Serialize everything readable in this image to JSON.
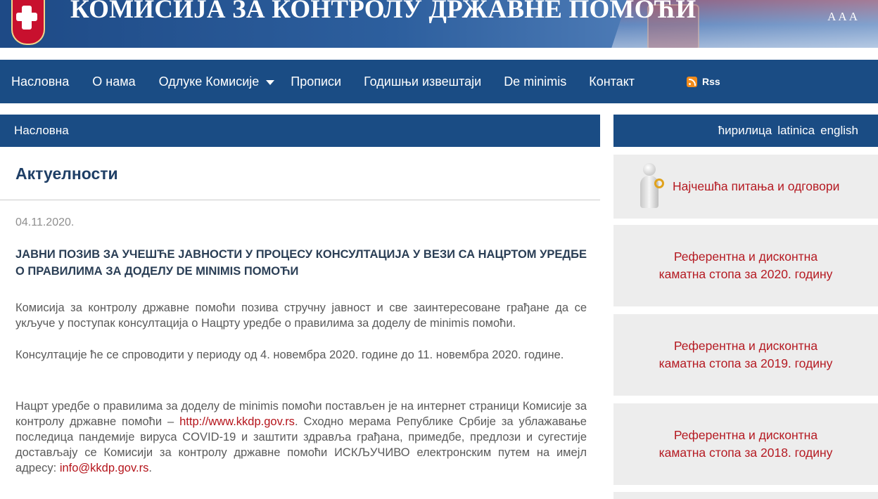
{
  "header": {
    "title": "КОМИСИЈА ЗА КОНТРОЛУ ДРЖАВНЕ ПОМОЋИ",
    "font_size_controls": "AAA"
  },
  "nav": {
    "items": [
      "Насловна",
      "О нама",
      "Одлуке Комисије",
      "Прописи",
      "Годишњи извештаји",
      "De minimis",
      "Контакт"
    ],
    "rss": "Rss"
  },
  "breadcrumb": "Насловна",
  "languages": [
    "ћирилица",
    "latinica",
    "english"
  ],
  "main": {
    "section_title": "Актуелности",
    "post": {
      "date": "04.11.2020.",
      "title": "ЈАВНИ ПОЗИВ ЗА УЧЕШЋЕ ЈАВНОСТИ У ПРОЦЕСУ КОНСУЛТАЦИЈА У ВЕЗИ СА НАЦРТОМ УРЕДБЕ О ПРАВИЛИМА ЗА ДОДЕЛУ DE MINIMIS ПОМОЋИ",
      "p1": "Комисија за контролу државне помоћи позива стручну јавност и све заинтересоване грађане да се укључе у поступак консултација о Нацрту уредбе о правилима за доделу de minimis помоћи.",
      "p2": "Консултације ће се спроводити у периоду од 4. новембра 2020. године до 11. новембра 2020. године.",
      "p3_part1": "Нацрт уредбе о правилима за доделу de minimis помоћи постављен је на интернет страници Комисије за контролу државне помоћи – ",
      "p3_link": "http://www.kkdp.gov.rs",
      "p3_part2": ". Сходно мерама Републике Србије за ублажавање последица пандемије вируса COVID-19 и заштити здравља грађана, примедбе, предлози и сугестије достављају се Комисији за контролу државне помоћи ИСКЉУЧИВО електронским путем на имејл адресу: ",
      "p3_email": "info@kkdp.gov.rs",
      "p3_end": "."
    }
  },
  "sidebar": {
    "faq": "Најчешћа питања и одговори",
    "rates": [
      {
        "line1": "Референтна и дисконтна",
        "line2": "каматна стопа за 2020. годину"
      },
      {
        "line1": "Референтна и дисконтна",
        "line2": "каматна стопа за 2019. годину"
      },
      {
        "line1": "Референтна и дисконтна",
        "line2": "каматна стопа за 2018. годину"
      }
    ]
  },
  "colors": {
    "nav_bg": "#1a4c84",
    "accent_red": "#b5141b",
    "sidebar_bg": "#ededed"
  }
}
